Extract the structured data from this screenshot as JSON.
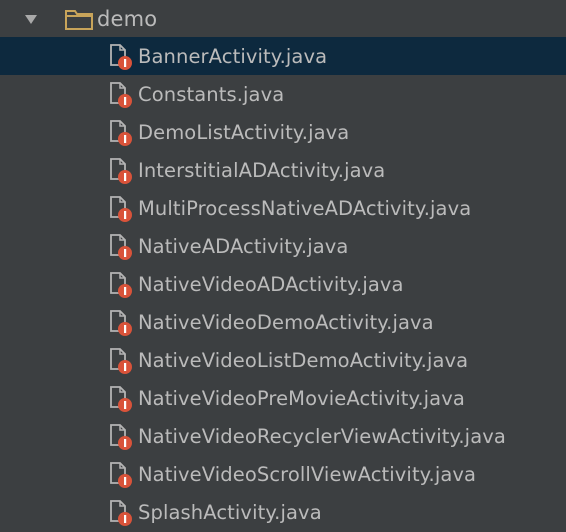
{
  "folder": {
    "name": "demo",
    "expanded": true,
    "icon": "folder-icon"
  },
  "files": [
    {
      "name": "BannerActivity.java",
      "selected": true
    },
    {
      "name": "Constants.java",
      "selected": false
    },
    {
      "name": "DemoListActivity.java",
      "selected": false
    },
    {
      "name": "InterstitialADActivity.java",
      "selected": false
    },
    {
      "name": "MultiProcessNativeADActivity.java",
      "selected": false
    },
    {
      "name": "NativeADActivity.java",
      "selected": false
    },
    {
      "name": "NativeVideoADActivity.java",
      "selected": false
    },
    {
      "name": "NativeVideoDemoActivity.java",
      "selected": false
    },
    {
      "name": "NativeVideoListDemoActivity.java",
      "selected": false
    },
    {
      "name": "NativeVideoPreMovieActivity.java",
      "selected": false
    },
    {
      "name": "NativeVideoRecyclerViewActivity.java",
      "selected": false
    },
    {
      "name": "NativeVideoScrollViewActivity.java",
      "selected": false
    },
    {
      "name": "SplashActivity.java",
      "selected": false
    }
  ],
  "colors": {
    "background": "#3c3f41",
    "selection": "#0d293e",
    "text": "#bbbbbb",
    "folder": "#c8a45a",
    "file_icon": "#b4b4b4",
    "badge": "#d9533a"
  }
}
